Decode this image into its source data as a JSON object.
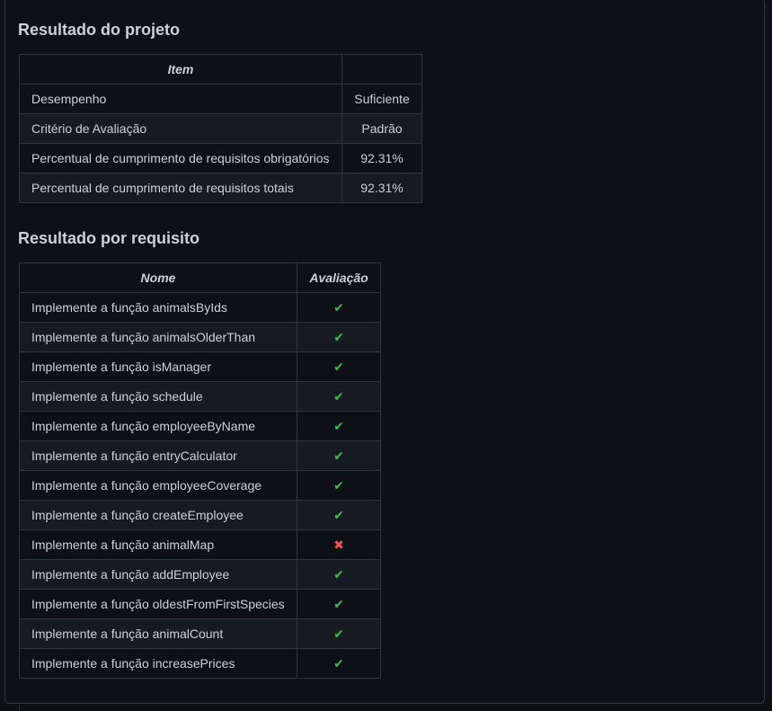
{
  "sections": {
    "projeto_title": "Resultado do projeto",
    "requisito_title": "Resultado por requisito"
  },
  "projeto_table": {
    "headers": [
      "Item",
      ""
    ],
    "rows": [
      {
        "item": "Desempenho",
        "value": "Suficiente"
      },
      {
        "item": "Critério de Avaliação",
        "value": "Padrão"
      },
      {
        "item": "Percentual de cumprimento de requisitos obrigatórios",
        "value": "92.31%"
      },
      {
        "item": "Percentual de cumprimento de requisitos totais",
        "value": "92.31%"
      }
    ]
  },
  "requisito_table": {
    "headers": [
      "Nome",
      "Avaliação"
    ],
    "rows": [
      {
        "name": "Implemente a função animalsByIds",
        "result": "pass"
      },
      {
        "name": "Implemente a função animalsOlderThan",
        "result": "pass"
      },
      {
        "name": "Implemente a função isManager",
        "result": "pass"
      },
      {
        "name": "Implemente a função schedule",
        "result": "pass"
      },
      {
        "name": "Implemente a função employeeByName",
        "result": "pass"
      },
      {
        "name": "Implemente a função entryCalculator",
        "result": "pass"
      },
      {
        "name": "Implemente a função employeeCoverage",
        "result": "pass"
      },
      {
        "name": "Implemente a função createEmployee",
        "result": "pass"
      },
      {
        "name": "Implemente a função animalMap",
        "result": "fail"
      },
      {
        "name": "Implemente a função addEmployee",
        "result": "pass"
      },
      {
        "name": "Implemente a função oldestFromFirstSpecies",
        "result": "pass"
      },
      {
        "name": "Implemente a função animalCount",
        "result": "pass"
      },
      {
        "name": "Implemente a função increasePrices",
        "result": "pass"
      }
    ]
  },
  "icons": {
    "pass": "check-mark-icon",
    "fail": "cross-mark-icon"
  },
  "colors": {
    "background": "#0d1117",
    "alt_row": "#161b22",
    "border": "#30363d",
    "text": "#c9d1d9",
    "pass": "#3fb950",
    "fail": "#f85149"
  }
}
